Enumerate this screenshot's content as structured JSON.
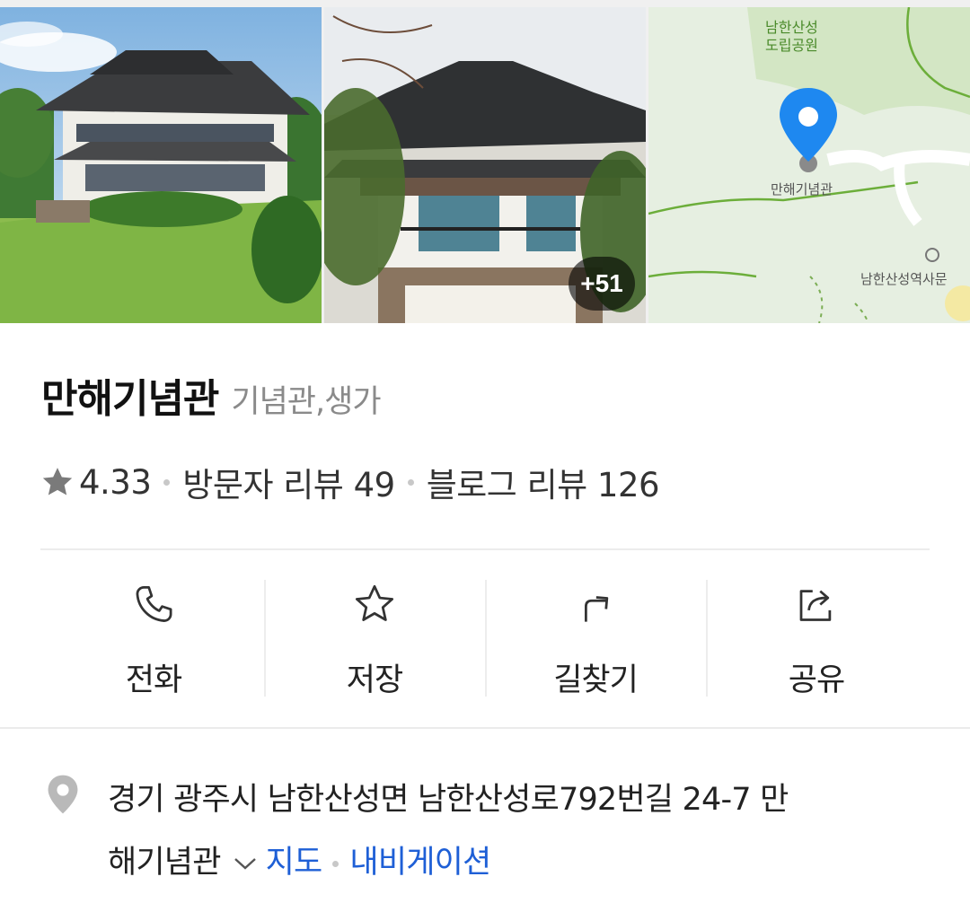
{
  "photos": {
    "more_count": "+51"
  },
  "map": {
    "park_label_line1": "남한산성",
    "park_label_line2": "도립공원",
    "poi_label": "만해기념관",
    "museum_label": "남한산성역사문"
  },
  "place": {
    "name": "만해기념관",
    "category": "기념관,생가"
  },
  "rating": {
    "score": "4.33",
    "visitor_reviews": "방문자 리뷰 49",
    "blog_reviews": "블로그 리뷰 126"
  },
  "actions": [
    {
      "label": "전화",
      "icon": "phone-icon"
    },
    {
      "label": "저장",
      "icon": "star-outline-icon"
    },
    {
      "label": "길찾기",
      "icon": "directions-icon"
    },
    {
      "label": "공유",
      "icon": "share-icon"
    }
  ],
  "address": {
    "line1": "경기 광주시 남한산성면 남한산성로792번길 24-7 만",
    "line2": "해기념관",
    "map_link": "지도",
    "navigation_link": "내비게이션"
  },
  "colors": {
    "link": "#1e5fd6",
    "map_pin": "#1e88f0",
    "map_bg": "#e6efe1"
  }
}
